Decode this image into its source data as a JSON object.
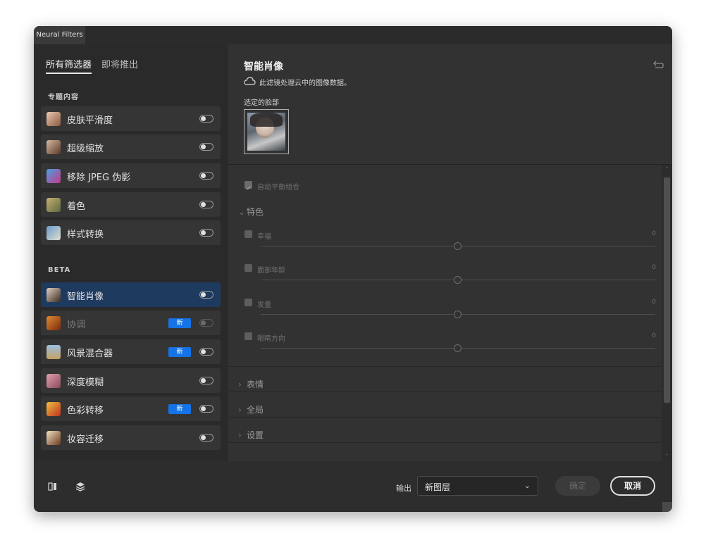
{
  "window": {
    "tab_title": "Neural Filters"
  },
  "left": {
    "tabs": [
      {
        "label": "所有筛选器",
        "active": true
      },
      {
        "label": "即将推出",
        "active": false
      }
    ],
    "sections": [
      {
        "label": "专题内容",
        "items": [
          {
            "label": "皮肤平滑度",
            "icon": "portrait-thumb-icon",
            "enabled": true,
            "badge": ""
          },
          {
            "label": "超级缩放",
            "icon": "portrait-thumb-icon",
            "enabled": true,
            "badge": ""
          },
          {
            "label": "移除 JPEG 伪影",
            "icon": "jpeg-thumb-icon",
            "enabled": true,
            "badge": ""
          },
          {
            "label": "着色",
            "icon": "colorize-thumb-icon",
            "enabled": true,
            "badge": ""
          },
          {
            "label": "样式转换",
            "icon": "style-thumb-icon",
            "enabled": true,
            "badge": ""
          }
        ]
      },
      {
        "label": "BETA",
        "items": [
          {
            "label": "智能肖像",
            "icon": "portrait-thumb-icon",
            "enabled": true,
            "badge": "",
            "selected": true
          },
          {
            "label": "协调",
            "icon": "harmonize-thumb-icon",
            "enabled": false,
            "badge": "新"
          },
          {
            "label": "风景混合器",
            "icon": "landscape-thumb-icon",
            "enabled": true,
            "badge": "新"
          },
          {
            "label": "深度模糊",
            "icon": "depth-thumb-icon",
            "enabled": true,
            "badge": ""
          },
          {
            "label": "色彩转移",
            "icon": "color-transfer-thumb-icon",
            "enabled": true,
            "badge": "新"
          },
          {
            "label": "妆容迁移",
            "icon": "makeup-thumb-icon",
            "enabled": true,
            "badge": ""
          }
        ]
      }
    ]
  },
  "right": {
    "title": "智能肖像",
    "cloud_note": "此滤镜处理云中的图像数据。",
    "face_label": "选定的脸部",
    "auto_balance_label": "自动平衡组合",
    "groups": [
      {
        "label": "特色",
        "expanded": true,
        "controls": [
          {
            "label": "幸福",
            "value": "0"
          },
          {
            "label": "面部年龄",
            "value": "0"
          },
          {
            "label": "发量",
            "value": "0"
          },
          {
            "label": "眼睛方向",
            "value": "0"
          }
        ]
      },
      {
        "label": "表情",
        "expanded": false
      },
      {
        "label": "全局",
        "expanded": false
      },
      {
        "label": "设置",
        "expanded": false
      }
    ]
  },
  "bottom": {
    "output_label": "输出",
    "output_value": "新图层",
    "ok_label": "确定",
    "cancel_label": "取消"
  },
  "colors": {
    "accent": "#1473e6",
    "selected_row": "#1f3a5f",
    "panel_bg": "#323232",
    "sidebar_bg": "#2a2a2a"
  }
}
